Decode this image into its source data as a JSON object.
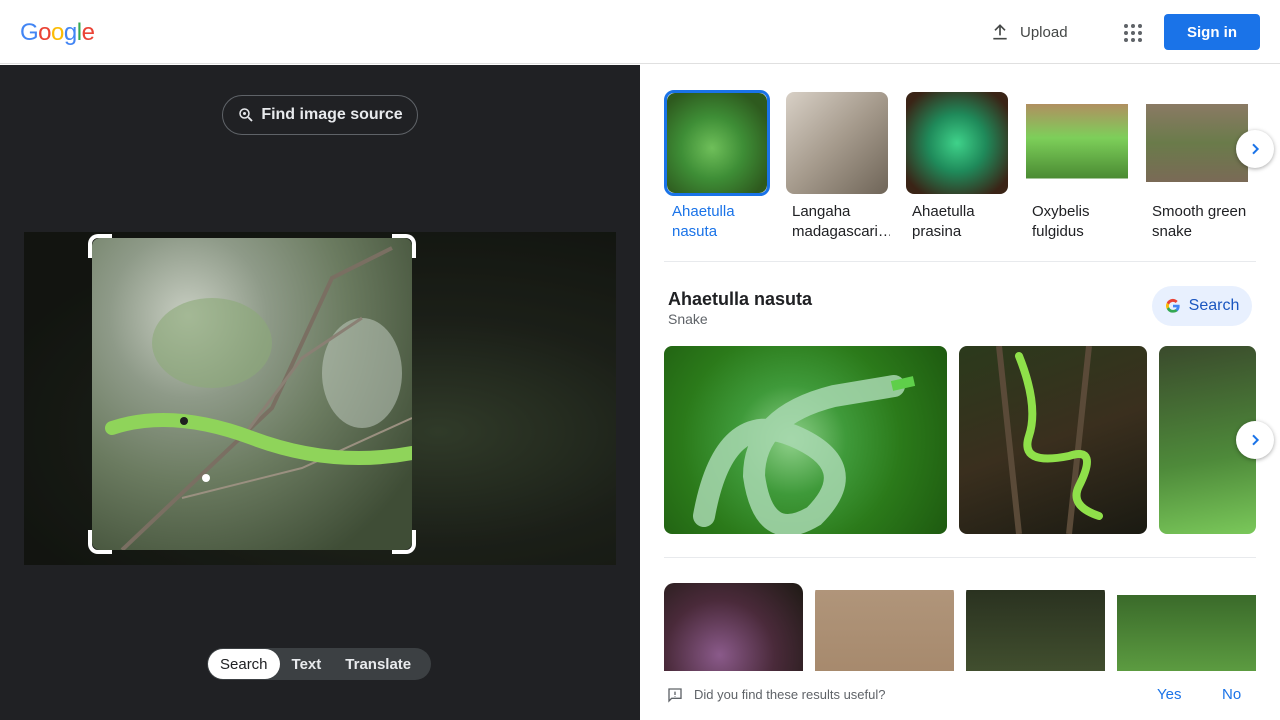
{
  "header": {
    "logo_text": "Google",
    "upload_label": "Upload",
    "signin_label": "Sign in"
  },
  "left_panel": {
    "find_source_label": "Find image source",
    "modes": [
      {
        "label": "Search",
        "active": true
      },
      {
        "label": "Text",
        "active": false
      },
      {
        "label": "Translate",
        "active": false
      }
    ]
  },
  "results": {
    "related_chips": [
      {
        "label": "Ahaetulla nasuta",
        "active": true
      },
      {
        "label": "Langaha madagascari…",
        "active": false
      },
      {
        "label": "Ahaetulla prasina",
        "active": false
      },
      {
        "label": "Oxybelis fulgidus",
        "active": false
      },
      {
        "label": "Smooth green snake",
        "active": false
      }
    ],
    "entity": {
      "title": "Ahaetulla nasuta",
      "subtitle": "Snake",
      "search_label": "Search"
    },
    "feedback": {
      "question": "Did you find these results useful?",
      "yes_label": "Yes",
      "no_label": "No"
    }
  },
  "colors": {
    "accent": "#1a73e8",
    "dark_panel": "#202124"
  },
  "icons": {
    "upload": "upload-icon",
    "apps": "apps-grid-icon",
    "lens": "lens-search-icon",
    "next": "chevron-right-icon",
    "google_g": "google-g-icon",
    "feedback": "feedback-icon"
  }
}
